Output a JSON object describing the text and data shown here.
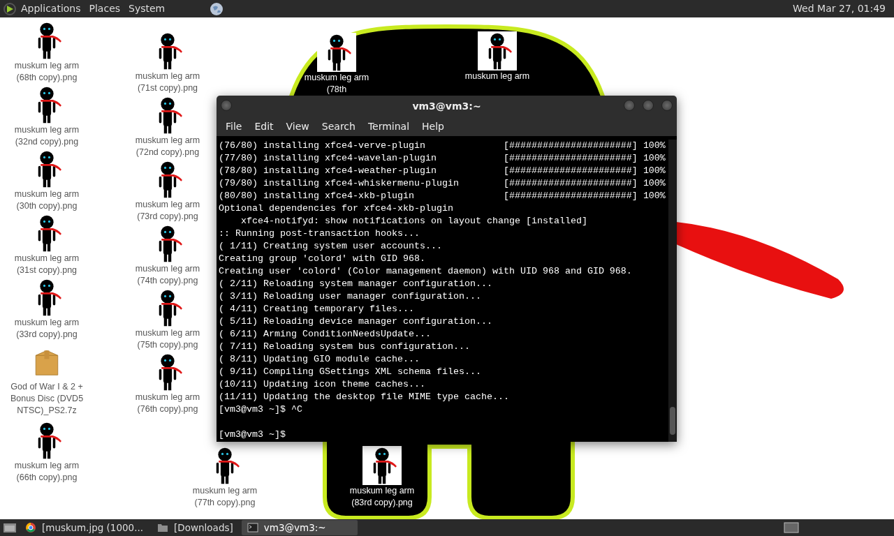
{
  "top_panel": {
    "menus": [
      "Applications",
      "Places",
      "System"
    ],
    "clock": "Wed Mar 27, 01:49"
  },
  "desktop_icons": [
    {
      "kind": "image",
      "label": "muskum leg arm (68th copy).png"
    },
    {
      "kind": "image",
      "label": "muskum leg arm (32nd copy).png"
    },
    {
      "kind": "image",
      "label": "muskum leg arm (30th copy).png"
    },
    {
      "kind": "image",
      "label": "muskum leg arm (31st copy).png"
    },
    {
      "kind": "image",
      "label": "muskum leg arm (33rd copy).png"
    },
    {
      "kind": "archive",
      "label": "God of War I & 2 + Bonus Disc (DVD5 NTSC)_PS2.7z"
    },
    {
      "kind": "image",
      "label": "muskum leg arm (66th copy).png"
    },
    {
      "kind": "image",
      "label": "muskum leg arm (71st copy).png"
    },
    {
      "kind": "image",
      "label": "muskum leg arm (72nd copy).png"
    },
    {
      "kind": "image",
      "label": "muskum leg arm (73rd copy).png"
    },
    {
      "kind": "image",
      "label": "muskum leg arm (74th copy).png"
    },
    {
      "kind": "image",
      "label": "muskum leg arm (75th copy).png"
    },
    {
      "kind": "image",
      "label": "muskum leg arm (76th copy).png"
    },
    {
      "kind": "image",
      "label": "muskum leg arm (77th copy).png"
    },
    {
      "kind": "image",
      "label": "muskum leg arm (78th"
    },
    {
      "kind": "image",
      "label": "muskum leg arm"
    },
    {
      "kind": "image",
      "label": "muskum leg arm (83rd copy).png"
    }
  ],
  "terminal": {
    "title": "vm3@vm3:~",
    "menu": [
      "File",
      "Edit",
      "View",
      "Search",
      "Terminal",
      "Help"
    ],
    "lines": [
      {
        "kind": "progress",
        "text": "(76/80) installing xfce4-verve-plugin",
        "bar": "[######################]",
        "percent": "100%"
      },
      {
        "kind": "progress",
        "text": "(77/80) installing xfce4-wavelan-plugin",
        "bar": "[######################]",
        "percent": "100%"
      },
      {
        "kind": "progress",
        "text": "(78/80) installing xfce4-weather-plugin",
        "bar": "[######################]",
        "percent": "100%"
      },
      {
        "kind": "progress",
        "text": "(79/80) installing xfce4-whiskermenu-plugin",
        "bar": "[######################]",
        "percent": "100%"
      },
      {
        "kind": "progress",
        "text": "(80/80) installing xfce4-xkb-plugin",
        "bar": "[######################]",
        "percent": "100%"
      },
      {
        "kind": "text",
        "text": "Optional dependencies for xfce4-xkb-plugin"
      },
      {
        "kind": "text",
        "text": "    xfce4-notifyd: show notifications on layout change [installed]"
      },
      {
        "kind": "text",
        "text": ":: Running post-transaction hooks..."
      },
      {
        "kind": "text",
        "text": "( 1/11) Creating system user accounts..."
      },
      {
        "kind": "text",
        "text": "Creating group 'colord' with GID 968."
      },
      {
        "kind": "text",
        "text": "Creating user 'colord' (Color management daemon) with UID 968 and GID 968."
      },
      {
        "kind": "text",
        "text": "( 2/11) Reloading system manager configuration..."
      },
      {
        "kind": "text",
        "text": "( 3/11) Reloading user manager configuration..."
      },
      {
        "kind": "text",
        "text": "( 4/11) Creating temporary files..."
      },
      {
        "kind": "text",
        "text": "( 5/11) Reloading device manager configuration..."
      },
      {
        "kind": "text",
        "text": "( 6/11) Arming ConditionNeedsUpdate..."
      },
      {
        "kind": "text",
        "text": "( 7/11) Reloading system bus configuration..."
      },
      {
        "kind": "text",
        "text": "( 8/11) Updating GIO module cache..."
      },
      {
        "kind": "text",
        "text": "( 9/11) Compiling GSettings XML schema files..."
      },
      {
        "kind": "text",
        "text": "(10/11) Updating icon theme caches..."
      },
      {
        "kind": "text",
        "text": "(11/11) Updating the desktop file MIME type cache..."
      },
      {
        "kind": "text",
        "text": "[vm3@vm3 ~]$ ^C"
      },
      {
        "kind": "blank"
      },
      {
        "kind": "text",
        "text": "[vm3@vm3 ~]$"
      }
    ]
  },
  "taskbar": {
    "items": [
      {
        "kind": "browser",
        "label": "[muskum.jpg (1000...",
        "selected": false
      },
      {
        "kind": "folder",
        "label": "[Downloads]",
        "selected": false
      },
      {
        "kind": "terminal",
        "label": "vm3@vm3:~",
        "selected": true
      }
    ]
  }
}
